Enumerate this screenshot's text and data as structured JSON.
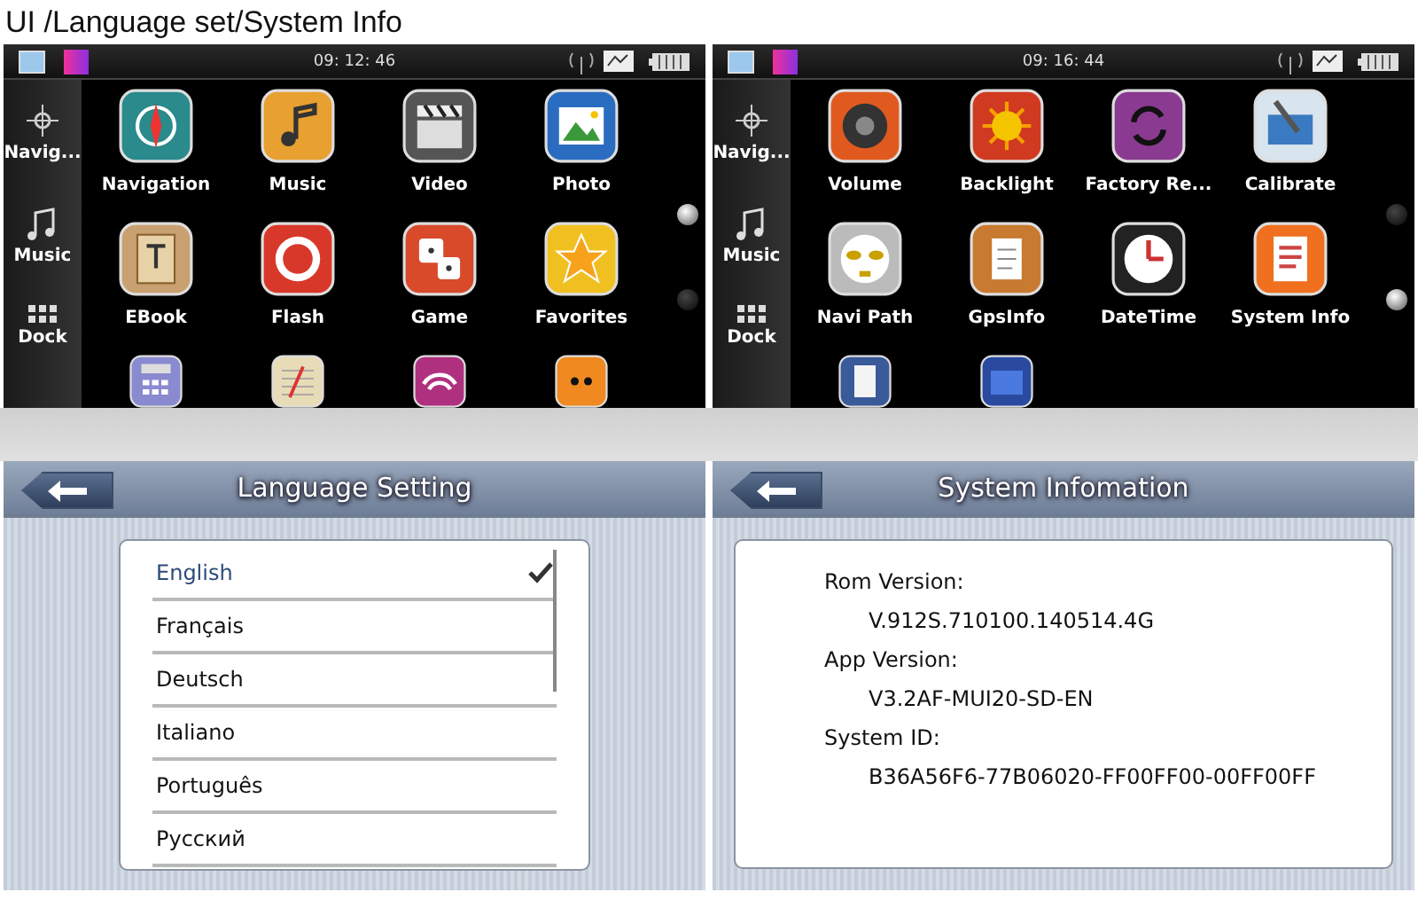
{
  "title": "UI /Language set/System Info",
  "screens": [
    {
      "status_bar": {
        "time": "09: 12: 46"
      },
      "sidebar": [
        {
          "label": "Navig..."
        },
        {
          "label": "Music"
        },
        {
          "label": "Dock"
        }
      ],
      "apps": [
        {
          "label": "Navigation",
          "cut_off": false
        },
        {
          "label": "Music",
          "cut_off": false
        },
        {
          "label": "Video",
          "cut_off": false
        },
        {
          "label": "Photo",
          "cut_off": false
        },
        {
          "label": "EBook",
          "cut_off": false
        },
        {
          "label": "Flash",
          "cut_off": false
        },
        {
          "label": "Game",
          "cut_off": false
        },
        {
          "label": "Favorites",
          "cut_off": false
        },
        {
          "cut_off": true
        },
        {
          "cut_off": true
        },
        {
          "cut_off": true
        },
        {
          "cut_off": true
        }
      ],
      "page_dots": [
        {
          "selected": true
        },
        {
          "selected": false
        }
      ]
    },
    {
      "status_bar": {
        "time": "09: 16: 44"
      },
      "sidebar": [
        {
          "label": "Navig..."
        },
        {
          "label": "Music"
        },
        {
          "label": "Dock"
        }
      ],
      "apps": [
        {
          "label": "Volume",
          "cut_off": false
        },
        {
          "label": "Backlight",
          "cut_off": false
        },
        {
          "label": "Factory Re...",
          "cut_off": false
        },
        {
          "label": "Calibrate",
          "cut_off": false
        },
        {
          "label": "Navi Path",
          "cut_off": false
        },
        {
          "label": "GpsInfo",
          "cut_off": false
        },
        {
          "label": "DateTime",
          "cut_off": false
        },
        {
          "label": "System Info",
          "cut_off": false
        },
        {
          "cut_off": true
        },
        {
          "cut_off": true
        }
      ],
      "page_dots": [
        {
          "selected": false
        },
        {
          "selected": true
        }
      ]
    }
  ],
  "language_setting": {
    "title": "Language Setting",
    "languages": [
      {
        "label": "English",
        "selected": true
      },
      {
        "label": "Français",
        "selected": false
      },
      {
        "label": "Deutsch",
        "selected": false
      },
      {
        "label": "Italiano",
        "selected": false
      },
      {
        "label": "Português",
        "selected": false
      },
      {
        "label": "Русский",
        "selected": false
      }
    ]
  },
  "system_info": {
    "title": "System Infomation",
    "fields": [
      {
        "label": "Rom Version:",
        "value": "V.912S.710100.140514.4G"
      },
      {
        "label": "App Version:",
        "value": "V3.2AF-MUI20-SD-EN"
      },
      {
        "label": "System ID:",
        "value": "B36A56F6-77B06020-FF00FF00-00FF00FF"
      }
    ]
  }
}
